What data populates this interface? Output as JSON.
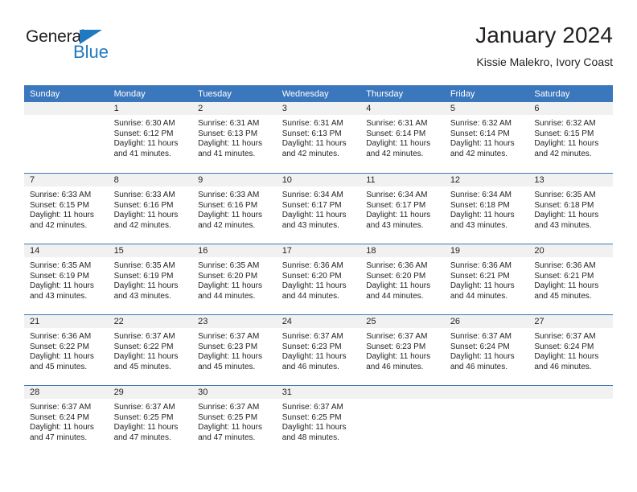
{
  "brand": {
    "name_dark": "General",
    "name_blue": "Blue",
    "triangle_icon": "blue-triangle-icon",
    "accent_color": "#1f7ac0"
  },
  "header": {
    "title": "January 2024",
    "subtitle": "Kissie Malekro, Ivory Coast"
  },
  "colors": {
    "header_blue": "#3b77bc",
    "daynum_band": "#f1f1f1",
    "text": "#231f20"
  },
  "weekday_headers": [
    "Sunday",
    "Monday",
    "Tuesday",
    "Wednesday",
    "Thursday",
    "Friday",
    "Saturday"
  ],
  "weeks": [
    [
      {
        "day": "",
        "sunrise": "",
        "sunset": "",
        "daylight1": "",
        "daylight2": ""
      },
      {
        "day": "1",
        "sunrise": "Sunrise: 6:30 AM",
        "sunset": "Sunset: 6:12 PM",
        "daylight1": "Daylight: 11 hours",
        "daylight2": "and 41 minutes."
      },
      {
        "day": "2",
        "sunrise": "Sunrise: 6:31 AM",
        "sunset": "Sunset: 6:13 PM",
        "daylight1": "Daylight: 11 hours",
        "daylight2": "and 41 minutes."
      },
      {
        "day": "3",
        "sunrise": "Sunrise: 6:31 AM",
        "sunset": "Sunset: 6:13 PM",
        "daylight1": "Daylight: 11 hours",
        "daylight2": "and 42 minutes."
      },
      {
        "day": "4",
        "sunrise": "Sunrise: 6:31 AM",
        "sunset": "Sunset: 6:14 PM",
        "daylight1": "Daylight: 11 hours",
        "daylight2": "and 42 minutes."
      },
      {
        "day": "5",
        "sunrise": "Sunrise: 6:32 AM",
        "sunset": "Sunset: 6:14 PM",
        "daylight1": "Daylight: 11 hours",
        "daylight2": "and 42 minutes."
      },
      {
        "day": "6",
        "sunrise": "Sunrise: 6:32 AM",
        "sunset": "Sunset: 6:15 PM",
        "daylight1": "Daylight: 11 hours",
        "daylight2": "and 42 minutes."
      }
    ],
    [
      {
        "day": "7",
        "sunrise": "Sunrise: 6:33 AM",
        "sunset": "Sunset: 6:15 PM",
        "daylight1": "Daylight: 11 hours",
        "daylight2": "and 42 minutes."
      },
      {
        "day": "8",
        "sunrise": "Sunrise: 6:33 AM",
        "sunset": "Sunset: 6:16 PM",
        "daylight1": "Daylight: 11 hours",
        "daylight2": "and 42 minutes."
      },
      {
        "day": "9",
        "sunrise": "Sunrise: 6:33 AM",
        "sunset": "Sunset: 6:16 PM",
        "daylight1": "Daylight: 11 hours",
        "daylight2": "and 42 minutes."
      },
      {
        "day": "10",
        "sunrise": "Sunrise: 6:34 AM",
        "sunset": "Sunset: 6:17 PM",
        "daylight1": "Daylight: 11 hours",
        "daylight2": "and 43 minutes."
      },
      {
        "day": "11",
        "sunrise": "Sunrise: 6:34 AM",
        "sunset": "Sunset: 6:17 PM",
        "daylight1": "Daylight: 11 hours",
        "daylight2": "and 43 minutes."
      },
      {
        "day": "12",
        "sunrise": "Sunrise: 6:34 AM",
        "sunset": "Sunset: 6:18 PM",
        "daylight1": "Daylight: 11 hours",
        "daylight2": "and 43 minutes."
      },
      {
        "day": "13",
        "sunrise": "Sunrise: 6:35 AM",
        "sunset": "Sunset: 6:18 PM",
        "daylight1": "Daylight: 11 hours",
        "daylight2": "and 43 minutes."
      }
    ],
    [
      {
        "day": "14",
        "sunrise": "Sunrise: 6:35 AM",
        "sunset": "Sunset: 6:19 PM",
        "daylight1": "Daylight: 11 hours",
        "daylight2": "and 43 minutes."
      },
      {
        "day": "15",
        "sunrise": "Sunrise: 6:35 AM",
        "sunset": "Sunset: 6:19 PM",
        "daylight1": "Daylight: 11 hours",
        "daylight2": "and 43 minutes."
      },
      {
        "day": "16",
        "sunrise": "Sunrise: 6:35 AM",
        "sunset": "Sunset: 6:20 PM",
        "daylight1": "Daylight: 11 hours",
        "daylight2": "and 44 minutes."
      },
      {
        "day": "17",
        "sunrise": "Sunrise: 6:36 AM",
        "sunset": "Sunset: 6:20 PM",
        "daylight1": "Daylight: 11 hours",
        "daylight2": "and 44 minutes."
      },
      {
        "day": "18",
        "sunrise": "Sunrise: 6:36 AM",
        "sunset": "Sunset: 6:20 PM",
        "daylight1": "Daylight: 11 hours",
        "daylight2": "and 44 minutes."
      },
      {
        "day": "19",
        "sunrise": "Sunrise: 6:36 AM",
        "sunset": "Sunset: 6:21 PM",
        "daylight1": "Daylight: 11 hours",
        "daylight2": "and 44 minutes."
      },
      {
        "day": "20",
        "sunrise": "Sunrise: 6:36 AM",
        "sunset": "Sunset: 6:21 PM",
        "daylight1": "Daylight: 11 hours",
        "daylight2": "and 45 minutes."
      }
    ],
    [
      {
        "day": "21",
        "sunrise": "Sunrise: 6:36 AM",
        "sunset": "Sunset: 6:22 PM",
        "daylight1": "Daylight: 11 hours",
        "daylight2": "and 45 minutes."
      },
      {
        "day": "22",
        "sunrise": "Sunrise: 6:37 AM",
        "sunset": "Sunset: 6:22 PM",
        "daylight1": "Daylight: 11 hours",
        "daylight2": "and 45 minutes."
      },
      {
        "day": "23",
        "sunrise": "Sunrise: 6:37 AM",
        "sunset": "Sunset: 6:23 PM",
        "daylight1": "Daylight: 11 hours",
        "daylight2": "and 45 minutes."
      },
      {
        "day": "24",
        "sunrise": "Sunrise: 6:37 AM",
        "sunset": "Sunset: 6:23 PM",
        "daylight1": "Daylight: 11 hours",
        "daylight2": "and 46 minutes."
      },
      {
        "day": "25",
        "sunrise": "Sunrise: 6:37 AM",
        "sunset": "Sunset: 6:23 PM",
        "daylight1": "Daylight: 11 hours",
        "daylight2": "and 46 minutes."
      },
      {
        "day": "26",
        "sunrise": "Sunrise: 6:37 AM",
        "sunset": "Sunset: 6:24 PM",
        "daylight1": "Daylight: 11 hours",
        "daylight2": "and 46 minutes."
      },
      {
        "day": "27",
        "sunrise": "Sunrise: 6:37 AM",
        "sunset": "Sunset: 6:24 PM",
        "daylight1": "Daylight: 11 hours",
        "daylight2": "and 46 minutes."
      }
    ],
    [
      {
        "day": "28",
        "sunrise": "Sunrise: 6:37 AM",
        "sunset": "Sunset: 6:24 PM",
        "daylight1": "Daylight: 11 hours",
        "daylight2": "and 47 minutes."
      },
      {
        "day": "29",
        "sunrise": "Sunrise: 6:37 AM",
        "sunset": "Sunset: 6:25 PM",
        "daylight1": "Daylight: 11 hours",
        "daylight2": "and 47 minutes."
      },
      {
        "day": "30",
        "sunrise": "Sunrise: 6:37 AM",
        "sunset": "Sunset: 6:25 PM",
        "daylight1": "Daylight: 11 hours",
        "daylight2": "and 47 minutes."
      },
      {
        "day": "31",
        "sunrise": "Sunrise: 6:37 AM",
        "sunset": "Sunset: 6:25 PM",
        "daylight1": "Daylight: 11 hours",
        "daylight2": "and 48 minutes."
      },
      {
        "day": "",
        "sunrise": "",
        "sunset": "",
        "daylight1": "",
        "daylight2": ""
      },
      {
        "day": "",
        "sunrise": "",
        "sunset": "",
        "daylight1": "",
        "daylight2": ""
      },
      {
        "day": "",
        "sunrise": "",
        "sunset": "",
        "daylight1": "",
        "daylight2": ""
      }
    ]
  ]
}
